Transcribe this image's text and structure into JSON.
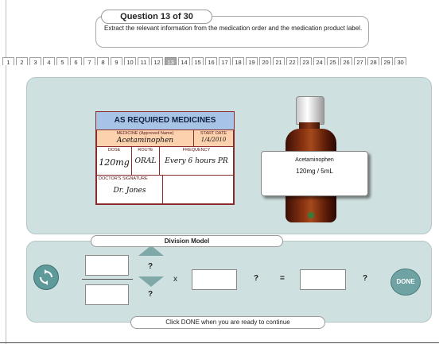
{
  "question": {
    "header": "Question 13 of 30",
    "prompt": "Extract the relevant information from the medication order and the medication product label."
  },
  "nav": {
    "items": [
      "1",
      "2",
      "3",
      "4",
      "5",
      "6",
      "7",
      "8",
      "9",
      "10",
      "11",
      "12",
      "13",
      "14",
      "15",
      "16",
      "17",
      "18",
      "19",
      "20",
      "21",
      "22",
      "23",
      "24",
      "25",
      "26",
      "27",
      "28",
      "29",
      "30"
    ],
    "current": "13"
  },
  "order": {
    "title": "AS REQUIRED MEDICINES",
    "medicine_label": "MEDICINE (Approved Name)",
    "medicine_value": "Acetaminophen",
    "start_label": "START DATE",
    "start_value": "1/4/2010",
    "dose_label": "DOSE",
    "dose_value": "120mg",
    "route_label": "ROUTE",
    "route_value": "ORAL",
    "frequency_label": "FREQUENCY",
    "frequency_value": "Every 6 hours PR",
    "signature_label": "DOCTOR'S SIGNATURE",
    "signature_value": "Dr. Jones"
  },
  "bottle": {
    "name": "Acetaminophen",
    "strength": "120mg / 5mL",
    "cap_color": "#d0d0d0",
    "glass_color": "#8b3412"
  },
  "model": {
    "title": "Division Model",
    "top_unit": "?",
    "bottom_unit": "?",
    "times": "x",
    "mid_unit": "?",
    "equals": "=",
    "result_unit": "?",
    "done_label": "DONE",
    "footer": "Click DONE when you are ready to continue"
  },
  "colors": {
    "panel": "#cfe0e0",
    "accent": "#6fa3a3",
    "current_nav": "#a6a6a6",
    "card_header": "#a7c4e6",
    "card_cells": "#fbd1ae"
  }
}
